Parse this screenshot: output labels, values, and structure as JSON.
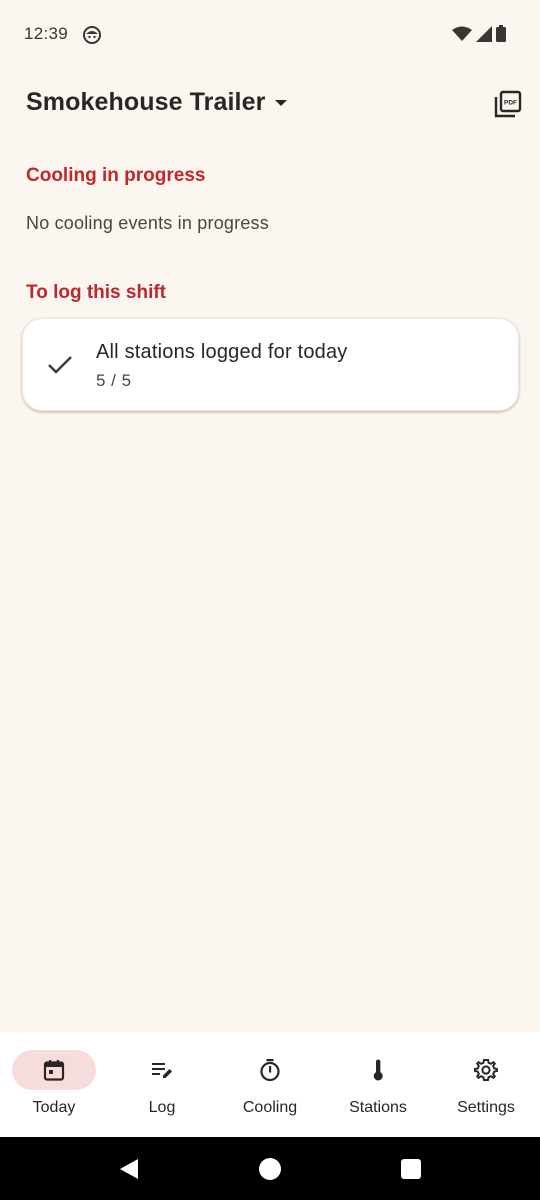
{
  "status_bar": {
    "time": "12:39"
  },
  "app_bar": {
    "title": "Smokehouse Trailer",
    "pdf_icon_text": "PDF"
  },
  "cooling_section": {
    "heading": "Cooling in progress",
    "empty_text": "No cooling events in progress"
  },
  "log_section": {
    "heading": "To log this shift",
    "card": {
      "title": "All stations logged for today",
      "progress": "5 / 5"
    }
  },
  "bottom_nav": {
    "items": [
      {
        "label": "Today",
        "icon": "calendar-icon",
        "active": true
      },
      {
        "label": "Log",
        "icon": "edit-list-icon",
        "active": false
      },
      {
        "label": "Cooling",
        "icon": "timer-icon",
        "active": false
      },
      {
        "label": "Stations",
        "icon": "thermometer-icon",
        "active": false
      },
      {
        "label": "Settings",
        "icon": "gear-icon",
        "active": false
      }
    ]
  },
  "colors": {
    "background": "#FBF7F0",
    "accent": "#C0272D",
    "active_pill": "#F6DCDC"
  }
}
